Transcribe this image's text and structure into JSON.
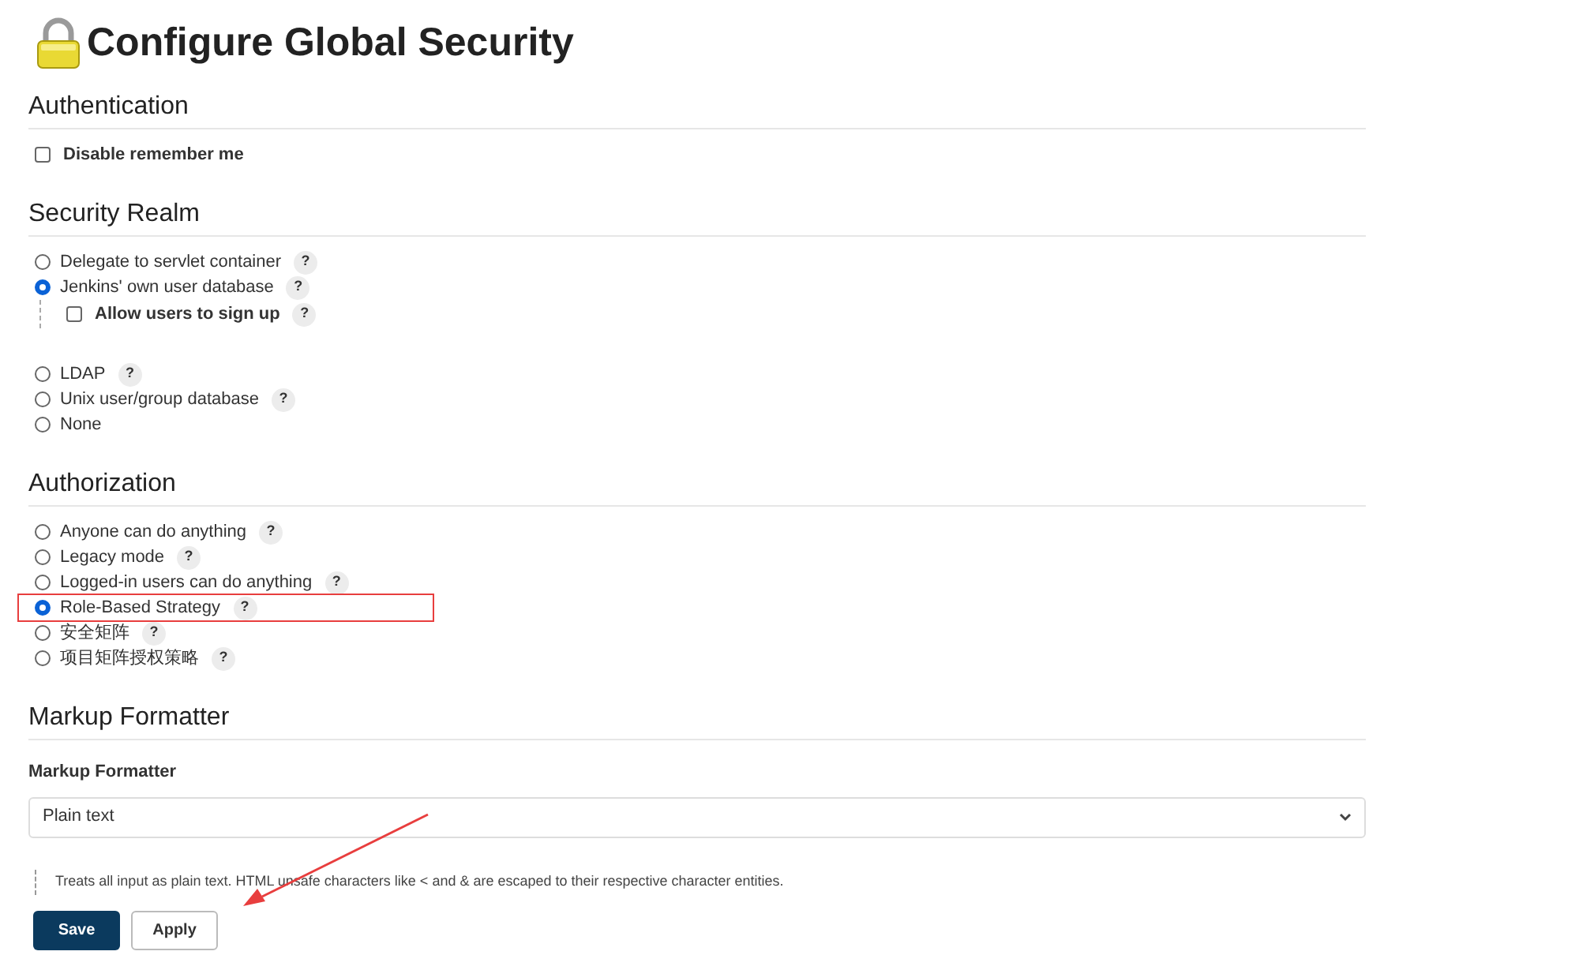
{
  "title": "Configure Global Security",
  "sections": [
    {
      "kind": "options",
      "heading": "Authentication",
      "items": [
        {
          "kind": "checkbox",
          "label": "Disable remember me",
          "checked": false
        }
      ]
    },
    {
      "kind": "options",
      "heading": "Security Realm",
      "items": [
        {
          "kind": "radio",
          "label": "Delegate to servlet container",
          "selected": false,
          "help": "?"
        },
        {
          "kind": "radio",
          "label": "Jenkins' own user database",
          "selected": true,
          "help": "?",
          "children": [
            {
              "kind": "checkbox",
              "label": "Allow users to sign up",
              "checked": false,
              "help": "?"
            }
          ]
        },
        {
          "kind": "radio",
          "label": "LDAP",
          "selected": false,
          "help": "?"
        },
        {
          "kind": "radio",
          "label": "Unix user/group database",
          "selected": false,
          "help": "?"
        },
        {
          "kind": "radio",
          "label": "None",
          "selected": false
        }
      ]
    },
    {
      "kind": "options",
      "heading": "Authorization",
      "items": [
        {
          "kind": "radio",
          "label": "Anyone can do anything",
          "selected": false,
          "help": "?"
        },
        {
          "kind": "radio",
          "label": "Legacy mode",
          "selected": false,
          "help": "?"
        },
        {
          "kind": "radio",
          "label": "Logged-in users can do anything",
          "selected": false,
          "help": "?"
        },
        {
          "kind": "radio",
          "label": "Role-Based Strategy",
          "selected": true,
          "help": "?",
          "annotated": true
        },
        {
          "kind": "radio",
          "label": "安全矩阵",
          "selected": false,
          "help": "?"
        },
        {
          "kind": "radio",
          "label": "项目矩阵授权策略",
          "selected": false,
          "help": "?"
        }
      ]
    },
    {
      "kind": "select",
      "heading": "Markup Formatter",
      "field_label": "Markup Formatter",
      "value": "Plain text",
      "help_text": "Treats all input as plain text. HTML unsafe characters like < and & are escaped to their respective character entities."
    }
  ],
  "buttons": [
    {
      "label": "Save",
      "primary": true
    },
    {
      "label": "Apply",
      "primary": false
    }
  ]
}
